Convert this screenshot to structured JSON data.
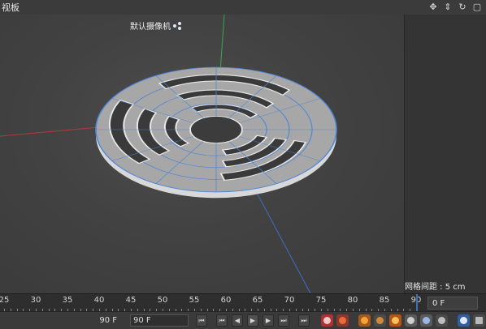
{
  "header": {
    "title": "视板",
    "tools": [
      "move-icon",
      "zoom-icon",
      "rotate-icon",
      "maximize-icon"
    ]
  },
  "viewport": {
    "camera_label": "默认摄像机",
    "grid_spacing": "网格间距 : 5 cm",
    "colors": {
      "background": "#424242",
      "x_axis": "#b33a3a",
      "y_axis": "#39a84a",
      "z_axis": "#3a6fc4",
      "mesh_face": "#a9a9a9",
      "mesh_wire": "#4f86d8"
    }
  },
  "timeline": {
    "ticks": [
      "25",
      "30",
      "35",
      "40",
      "45",
      "50",
      "55",
      "60",
      "65",
      "70",
      "75",
      "80",
      "85",
      "90"
    ],
    "current_frame": "0 F"
  },
  "transport": {
    "min_frame": "90 F",
    "max_frame": "90 F"
  }
}
